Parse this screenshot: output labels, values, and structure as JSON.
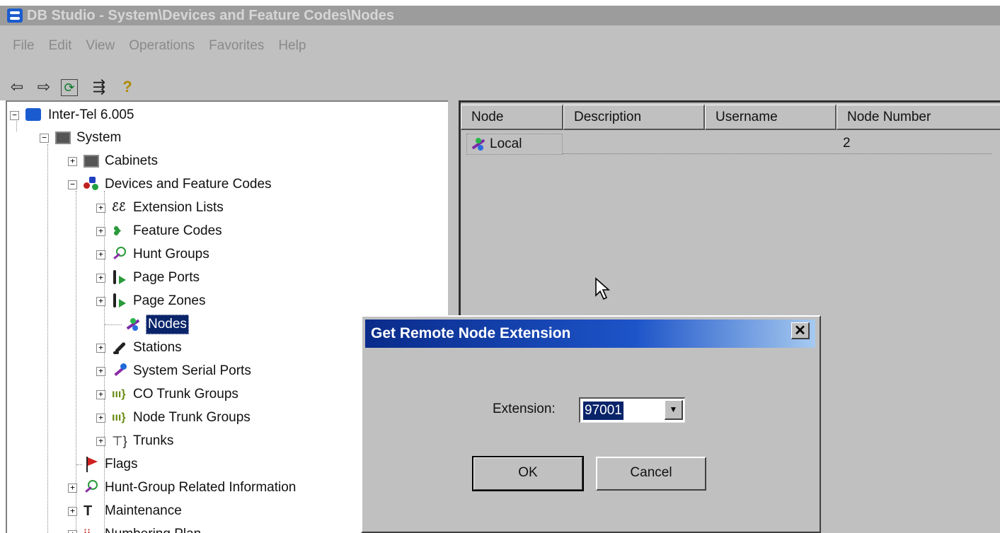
{
  "window": {
    "title": "DB Studio - System\\Devices and Feature Codes\\Nodes"
  },
  "menu": [
    "File",
    "Edit",
    "View",
    "Operations",
    "Favorites",
    "Help"
  ],
  "toolbar": {
    "back": "⇦",
    "forward": "⇨",
    "refresh": "⟳",
    "list": "⇶",
    "help": "?"
  },
  "tree": {
    "root": "Inter-Tel 6.005",
    "system": "System",
    "items": [
      "Cabinets",
      "Devices and Feature Codes",
      "Extension Lists",
      "Feature Codes",
      "Hunt Groups",
      "Page Ports",
      "Page Zones",
      "Nodes",
      "Stations",
      "System Serial Ports",
      "CO Trunk Groups",
      "Node Trunk Groups",
      "Trunks",
      "Flags",
      "Hunt-Group Related Information",
      "Maintenance",
      "Numbering Plan"
    ]
  },
  "list": {
    "columns": [
      "Node",
      "Description",
      "Username",
      "Node Number"
    ],
    "rows": [
      {
        "node": "Local",
        "description": "",
        "username": "",
        "node_number": "2"
      }
    ]
  },
  "dialog": {
    "title": "Get Remote Node Extension",
    "close": "✕",
    "extension_label": "Extension:",
    "extension_value": "97001",
    "ok_label": "OK",
    "cancel_label": "Cancel"
  }
}
